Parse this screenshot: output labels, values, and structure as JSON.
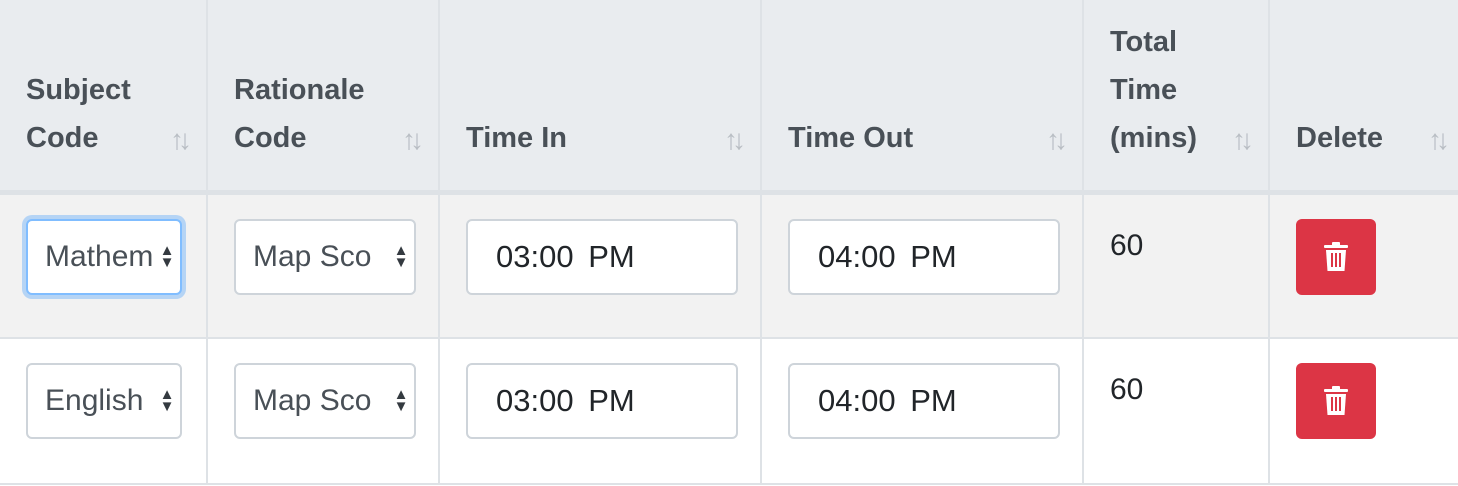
{
  "columns": {
    "subject": [
      "Subject",
      "Code"
    ],
    "rationale": [
      "Rationale",
      "Code"
    ],
    "time_in": "Time In",
    "time_out": "Time Out",
    "total": [
      "Total",
      "Time",
      "(mins)"
    ],
    "delete": "Delete"
  },
  "sort_icon": "sort-arrows-icon",
  "rows": [
    {
      "subject": "Mathem",
      "rationale": "Map Sco",
      "time_in": "03:00 PM",
      "time_out": "04:00 PM",
      "total": "60"
    },
    {
      "subject": "English",
      "rationale": "Map Sco",
      "time_in": "03:00 PM",
      "time_out": "04:00 PM",
      "total": "60"
    }
  ],
  "colors": {
    "header_bg": "#e9ecef",
    "striped_row_bg": "#f2f2f2",
    "delete_button": "#dc3545",
    "focus_border": "#80bdff"
  }
}
